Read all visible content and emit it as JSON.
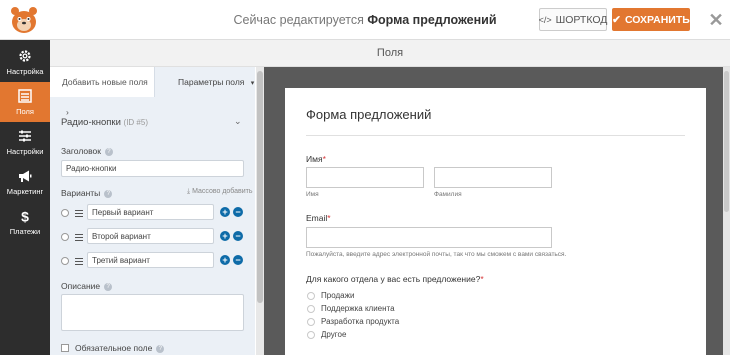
{
  "topbar": {
    "editing_prefix": "Сейчас редактируется",
    "form_name": "Форма предложений",
    "shortcode_label": "ШОРТКОД",
    "save_label": "СОХРАНИТЬ"
  },
  "leftnav": [
    {
      "label": "Настройка",
      "icon": "gear-icon"
    },
    {
      "label": "Поля",
      "icon": "fields-list-icon",
      "active": true
    },
    {
      "label": "Настройки",
      "icon": "sliders-icon"
    },
    {
      "label": "Маркетинг",
      "icon": "megaphone-icon"
    },
    {
      "label": "Платежи",
      "icon": "dollar-icon"
    }
  ],
  "panel_header": "Поля",
  "tabs": {
    "add_fields": "Добавить новые поля",
    "field_options": "Параметры поля"
  },
  "field_options": {
    "field_type": "Радио-кнопки",
    "field_id": "(ID #5)",
    "label_caption": "Заголовок",
    "label_value": "Радио-кнопки",
    "choices_caption": "Варианты",
    "bulk_add": "Массово добавить",
    "choices": [
      "Первый вариант",
      "Второй вариант",
      "Третий вариант"
    ],
    "description_caption": "Описание",
    "required_caption": "Обязательное поле"
  },
  "form": {
    "title": "Форма предложений",
    "name_label": "Имя",
    "first_name_sub": "Имя",
    "last_name_sub": "Фамилия",
    "email_label": "Email",
    "email_help": "Пожалуйста, введите адрес электронной почты, так что мы сможем с вами связаться.",
    "department_label": "Для какого отдела у вас есть предложение?",
    "departments": [
      "Продажи",
      "Поддержка клиента",
      "Разработка продукта",
      "Другое"
    ]
  },
  "colors": {
    "accent": "#e27730",
    "nav_bg": "#2d2d2d",
    "panel_bg": "#ebf0f6",
    "preview_bg": "#5a5a5a",
    "link_blue": "#0e6ba8"
  }
}
